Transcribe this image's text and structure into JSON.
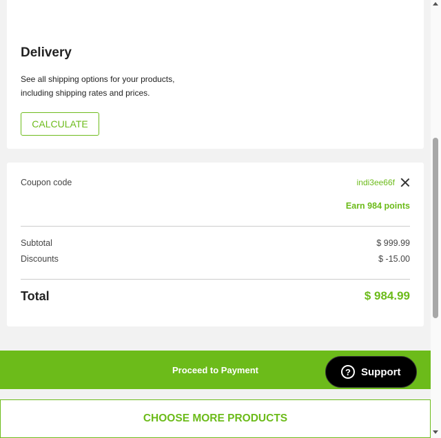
{
  "delivery": {
    "title": "Delivery",
    "description": "See all shipping options for your products, including shipping rates and prices.",
    "calculate_label": "CALCULATE"
  },
  "summary": {
    "coupon_label": "Coupon code",
    "coupon_value": "indi3ee66f",
    "points_prefix": "Earn ",
    "points_value": "984",
    "points_suffix": " points",
    "subtotal_label": "Subtotal",
    "subtotal_value": "$ 999.99",
    "discounts_label": "Discounts",
    "discounts_value": "$ -15.00",
    "total_label": "Total",
    "total_value": "$ 984.99"
  },
  "actions": {
    "proceed_label": "Proceed to Payment",
    "support_label": "Support",
    "choose_more_label": "CHOOSE MORE PRODUCTS"
  },
  "icons": {
    "close": "close-icon",
    "help": "help-circle-icon"
  },
  "colors": {
    "accent": "#6cbb1a",
    "support_bg": "#000000"
  }
}
